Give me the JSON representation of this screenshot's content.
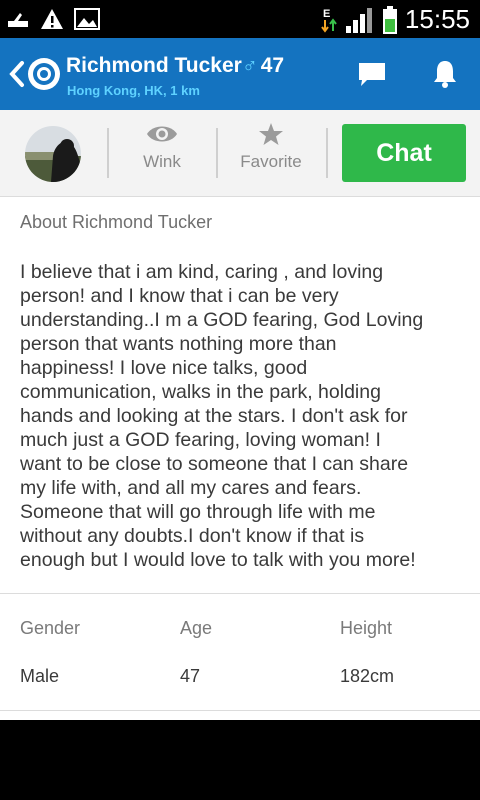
{
  "status_bar": {
    "time": "15:55",
    "network_type": "E",
    "icons": [
      "usb-icon",
      "warning-icon",
      "image-icon",
      "network-arrows-icon",
      "signal-icon",
      "battery-icon"
    ]
  },
  "app_bar": {
    "name": "Richmond Tucker",
    "gender_symbol": "♂",
    "age": "47",
    "location": "Hong Kong, HK, 1 km",
    "icons": [
      "back-icon",
      "app-logo-icon",
      "messages-icon",
      "notifications-bell-icon"
    ]
  },
  "actions": {
    "wink_label": "Wink",
    "favorite_label": "Favorite",
    "chat_label": "Chat"
  },
  "about": {
    "title": "About Richmond Tucker",
    "text": "I believe that i am kind, caring , and loving\nperson!  and I know that i can be very\nunderstanding..I m a GOD fearing, God Loving\nperson that wants nothing more than\nhappiness! I love nice talks, good\ncommunication, walks in the park, holding\nhands and looking at the stars. I don't ask for\nmuch  just a GOD fearing, loving woman! I\nwant to be close to someone that I can share\nmy life with, and all my cares and fears.\nSomeone that will go through life with me\nwithout any doubts.I don't know if that is\nenough but I would love to talk with you more!"
  },
  "details": {
    "gender_label": "Gender",
    "gender_value": "Male",
    "age_label": "Age",
    "age_value": "47",
    "height_label": "Height",
    "height_value": "182cm"
  },
  "colors": {
    "app_bar": "#1473c0",
    "accent_cyan": "#5fd2ff",
    "chat_button": "#2fb84a"
  }
}
